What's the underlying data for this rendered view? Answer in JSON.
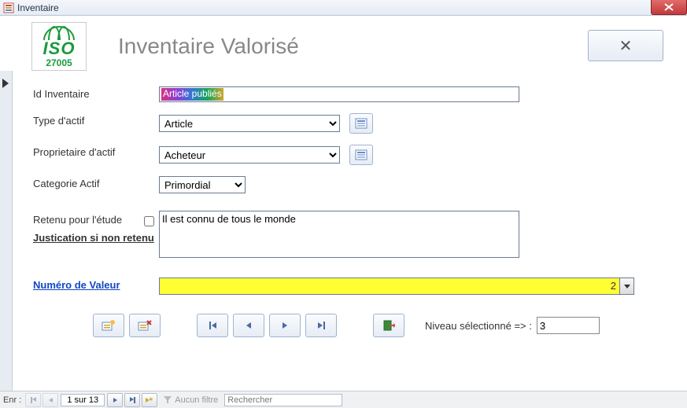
{
  "window": {
    "title": "Inventaire"
  },
  "header": {
    "logo": {
      "iso": "ISO",
      "number": "27005"
    },
    "title": "Inventaire Valorisé",
    "close_label": "✕"
  },
  "form": {
    "id_inventaire": {
      "label": "Id Inventaire",
      "value": "Article publiés"
    },
    "type_actif": {
      "label": "Type d'actif",
      "value": "Article",
      "options": [
        "Article"
      ]
    },
    "proprietaire_actif": {
      "label": "Proprietaire d'actif",
      "value": "Acheteur",
      "options": [
        "Acheteur"
      ]
    },
    "categorie_actif": {
      "label": "Categorie Actif",
      "value": "Primordial",
      "options": [
        "Primordial"
      ]
    },
    "retenu": {
      "label": "Retenu pour l'étude",
      "checked": false
    },
    "justification_label": "Justication si non retenu",
    "description": {
      "value": "Il est connu de tous le monde"
    },
    "numero_valeur": {
      "label": "Numéro de Valeur",
      "value": "2"
    },
    "niveau": {
      "label": "Niveau sélectionné => :",
      "value": "3"
    }
  },
  "recnav": {
    "label": "Enr :",
    "position": "1 sur 13",
    "filter_label": "Aucun filtre",
    "search_placeholder": "Rechercher"
  },
  "colors": {
    "accent": "#4a69a5",
    "highlight": "#ffff33",
    "logo": "#1a9a3a"
  }
}
